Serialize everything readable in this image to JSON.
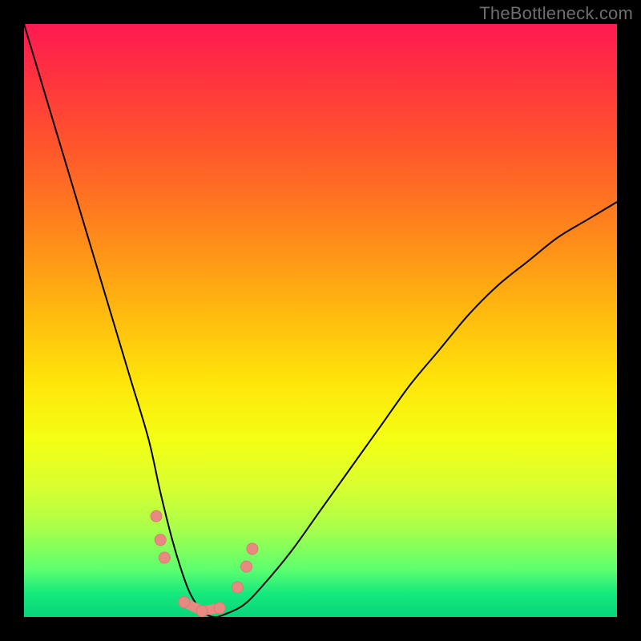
{
  "watermark": "TheBottleneck.com",
  "colors": {
    "frame": "#000000",
    "gradient_top": "#ff1a53",
    "gradient_bottom": "#06d67a",
    "curve": "#000000",
    "marker": "#e98a82"
  },
  "chart_data": {
    "type": "line",
    "title": "",
    "xlabel": "",
    "ylabel": "",
    "xlim": [
      0,
      100
    ],
    "ylim": [
      0,
      100
    ],
    "grid": false,
    "legend": false,
    "series": [
      {
        "name": "bottleneck-curve",
        "x": [
          0,
          3,
          6,
          9,
          12,
          15,
          18,
          21,
          23,
          25,
          26.5,
          28,
          30,
          32,
          34,
          37,
          40,
          45,
          50,
          55,
          60,
          65,
          70,
          75,
          80,
          85,
          90,
          95,
          100
        ],
        "y": [
          100,
          90,
          80,
          70,
          60,
          50,
          40,
          30,
          21,
          13,
          8,
          4,
          1,
          0,
          0.5,
          2,
          5,
          11,
          18,
          25,
          32,
          39,
          45,
          51,
          56,
          60,
          64,
          67,
          70
        ]
      }
    ],
    "markers": [
      {
        "x": 22.3,
        "y": 17.0
      },
      {
        "x": 23.0,
        "y": 13.0
      },
      {
        "x": 23.7,
        "y": 10.0
      },
      {
        "x": 27.0,
        "y": 2.5
      },
      {
        "x": 30.0,
        "y": 1.0
      },
      {
        "x": 33.0,
        "y": 1.5
      },
      {
        "x": 36.0,
        "y": 5.0
      },
      {
        "x": 37.5,
        "y": 8.5
      },
      {
        "x": 38.5,
        "y": 11.5
      }
    ],
    "marker_link": [
      {
        "x": 27.0,
        "y": 2.5
      },
      {
        "x": 30.0,
        "y": 1.0
      },
      {
        "x": 33.0,
        "y": 1.5
      }
    ]
  }
}
